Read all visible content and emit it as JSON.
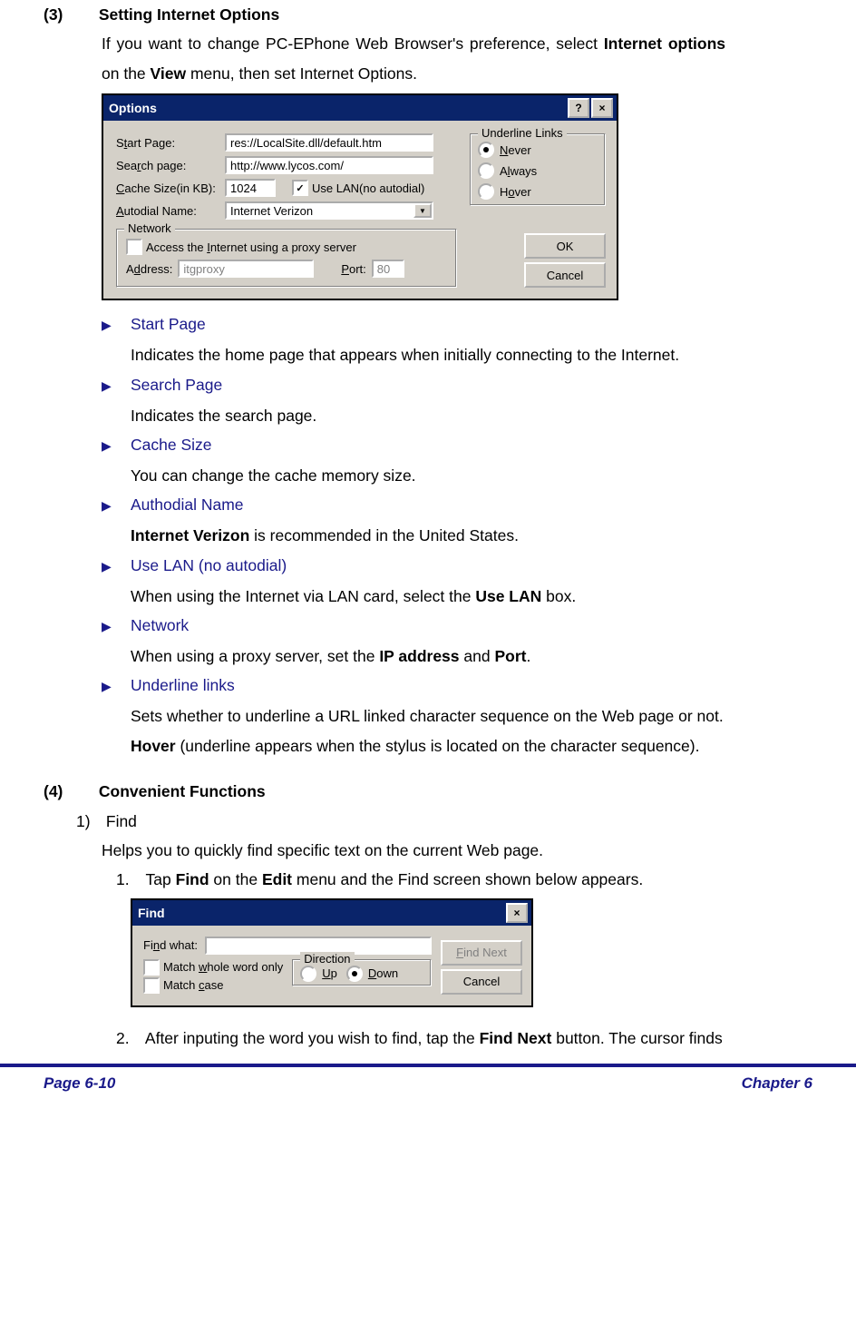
{
  "s3": {
    "num": "(3)",
    "title": "Setting Internet Options",
    "intro_a": "If you want to change PC-EPhone Web Browser's preference, select ",
    "intro_b": "Internet options",
    "intro_c": " on the ",
    "intro_d": "View",
    "intro_e": " menu, then set Internet Options."
  },
  "options_dlg": {
    "title": "Options",
    "help": "?",
    "close": "×",
    "start_page_lbl_pre": "S",
    "start_page_lbl_u": "t",
    "start_page_lbl_post": "art Page:",
    "start_page_val": "res://LocalSite.dll/default.htm",
    "search_page_lbl_pre": "Sea",
    "search_page_lbl_u": "r",
    "search_page_lbl_post": "ch page:",
    "search_page_val": "http://www.lycos.com/",
    "cache_lbl_pre": "",
    "cache_lbl_u": "C",
    "cache_lbl_post": "ache Size(in KB):",
    "cache_val": "1024",
    "use_lan_lbl": "Use LAN(no autodial)",
    "autodial_lbl_pre": "",
    "autodial_lbl_u": "A",
    "autodial_lbl_post": "utodial Name:",
    "autodial_val": "Internet Verizon",
    "net_legend": "Network",
    "proxy_lbl_pre": "Access the ",
    "proxy_lbl_u": "I",
    "proxy_lbl_post": "nternet using a proxy server",
    "addr_lbl_pre": "A",
    "addr_lbl_u": "d",
    "addr_lbl_post": "dress:",
    "addr_val": "itgproxy",
    "port_lbl_pre": "",
    "port_lbl_u": "P",
    "port_lbl_post": "ort:",
    "port_val": "80",
    "ul_legend": "Underline Links",
    "ul_never_u": "N",
    "ul_never_post": "ever",
    "ul_always_pre": "A",
    "ul_always_u": "l",
    "ul_always_post": "ways",
    "ul_hover_pre": "H",
    "ul_hover_u": "o",
    "ul_hover_post": "ver",
    "ok": "OK",
    "cancel": "Cancel"
  },
  "bullets": {
    "b1_label": "Start Page",
    "b1_desc": "Indicates the home page that appears when initially connecting to the Internet.",
    "b2_label": "Search Page",
    "b2_desc": "Indicates the search page.",
    "b3_label": "Cache Size",
    "b3_desc": "You can change the cache memory size.",
    "b4_label": "Authodial Name",
    "b4_desc_b": "Internet Verizon",
    "b4_desc_post": " is recommended in the United States.",
    "b5_label": "Use LAN (no autodial)",
    "b5_desc_pre": "When using the Internet via LAN card, select the ",
    "b5_desc_b": "Use LAN",
    "b5_desc_post": " box.",
    "b6_label": "Network",
    "b6_desc_pre": "When using a proxy server, set the ",
    "b6_desc_b1": "IP address",
    "b6_desc_mid": " and ",
    "b6_desc_b2": "Port",
    "b6_desc_post": ".",
    "b7_label": "Underline links",
    "b7_desc1": "Sets whether to underline a URL linked character sequence on the Web page or not.",
    "b7_desc2_b": "Hover",
    "b7_desc2_post": " (underline appears when the stylus is located on the character sequence)."
  },
  "s4": {
    "num": "(4)",
    "title": "Convenient Functions",
    "sub1_num": "1)",
    "sub1_title": "Find",
    "sub1_body": "Helps you to quickly find specific text on the current Web page.",
    "step1_num": "1.",
    "step1_pre": "Tap ",
    "step1_b1": "Find",
    "step1_mid": " on the ",
    "step1_b2": "Edit",
    "step1_post": " menu and the Find screen shown below appears.",
    "step2_num": "2.",
    "step2_pre": "After inputing the word you wish to find, tap the ",
    "step2_b": "Find Next",
    "step2_post": " button. The cursor finds"
  },
  "find_dlg": {
    "title": "Find",
    "close": "×",
    "find_what_lbl_pre": "Fi",
    "find_what_lbl_u": "n",
    "find_what_lbl_post": "d what:",
    "whole_pre": "Match ",
    "whole_u": "w",
    "whole_post": "hole word only",
    "case_pre": "Match ",
    "case_u": "c",
    "case_post": "ase",
    "dir_legend": "Direction",
    "up_u": "U",
    "up_post": "p",
    "down_u": "D",
    "down_post": "own",
    "find_next_u": "F",
    "find_next_post": "ind Next",
    "cancel": "Cancel"
  },
  "footer": {
    "left": "Page 6-10",
    "right": "Chapter 6"
  },
  "tri": "▶"
}
